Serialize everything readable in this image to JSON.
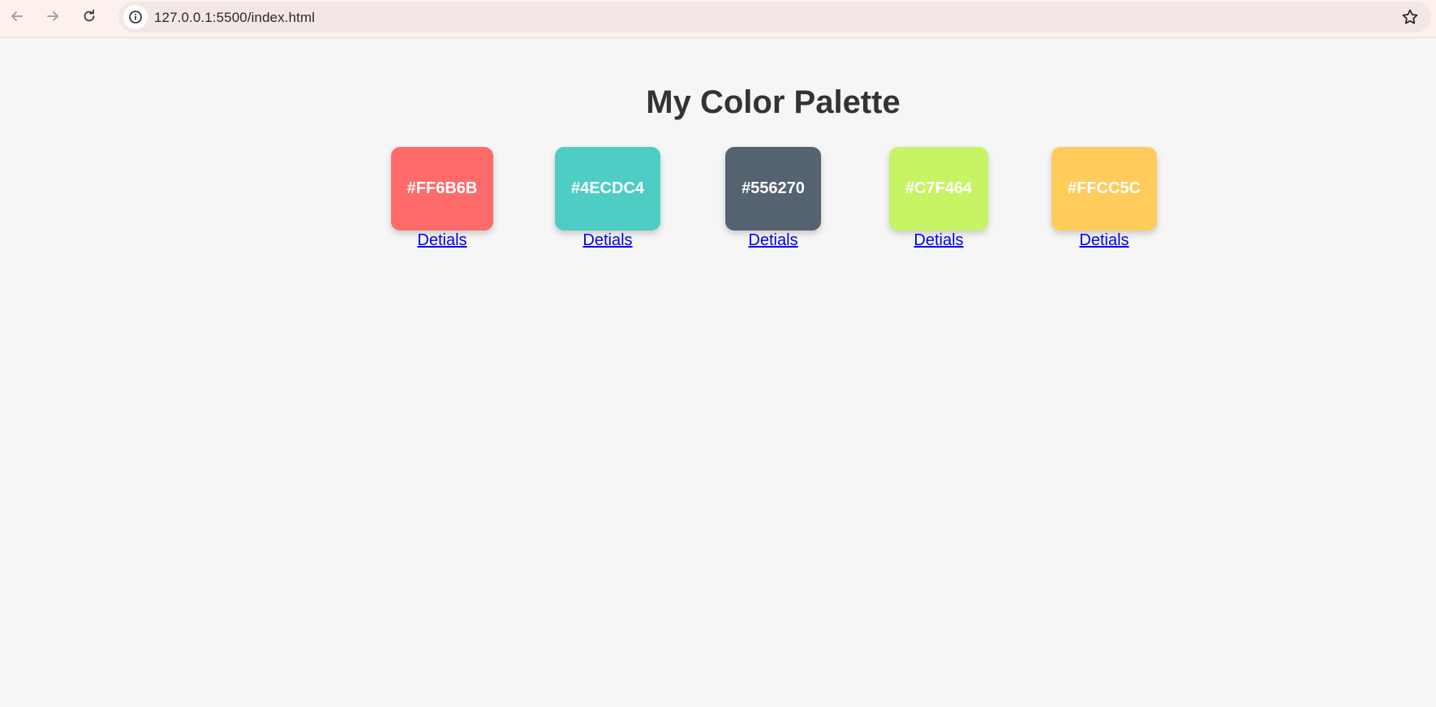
{
  "browser": {
    "url": "127.0.0.1:5500/index.html",
    "icons": {
      "back": "arrow-left-icon",
      "forward": "arrow-right-icon",
      "reload": "reload-icon",
      "site_info": "info-icon",
      "bookmark": "star-icon"
    }
  },
  "page": {
    "title": "My Color Palette"
  },
  "swatches": [
    {
      "hex": "#FF6B6B",
      "color": "#FF6B6B",
      "link": "Detials"
    },
    {
      "hex": "#4ECDC4",
      "color": "#4ECDC4",
      "link": "Detials"
    },
    {
      "hex": "#556270",
      "color": "#556270",
      "link": "Detials"
    },
    {
      "hex": "#C7F464",
      "color": "#C7F464",
      "link": "Detials"
    },
    {
      "hex": "#FFCC5C",
      "color": "#FFCC5C",
      "link": "Detials"
    }
  ],
  "colors": {
    "page_background": "#f6f6f6",
    "title_text": "#333333",
    "link": "#0000ee"
  }
}
